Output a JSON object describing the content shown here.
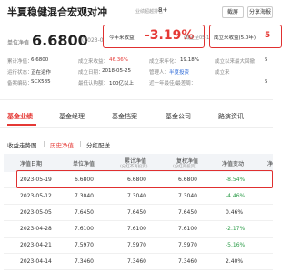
{
  "header": {
    "fund_name": "半夏稳健混合宏观对冲",
    "rating_label": "业绩超越排名",
    "rating_value": "8+",
    "screenshot_label": "截屏",
    "share_label": "分享海报"
  },
  "nav": {
    "label": "单位净值",
    "value": "6.6800",
    "date": "(2023-05-19)"
  },
  "return_box": {
    "label": "今年来收益",
    "value": "-3.19%",
    "note": "(截止至05-19)"
  },
  "since_box": {
    "label": "成立来收益(5.0年)",
    "value_partial": "5"
  },
  "info": {
    "row1": {
      "cum_label": "累计净值：",
      "cum_value": "6.6800",
      "since_label": "成立来收益：",
      "since_value": "46.36%",
      "ann_label": "成立来年化：",
      "ann_value": "19.18%",
      "dd_label": "成立以来最大回撤：",
      "dd_value": "5"
    },
    "row2": {
      "status_label": "运行状态：",
      "status_value": "正在运作",
      "date_label": "成立日期：",
      "date_value": "2018-05-25",
      "mgr_label": "管理人：",
      "mgr_value": "半夏投资",
      "extra_label": "成立来"
    },
    "row3": {
      "code_label": "备案编码：",
      "code_value": "SCX585",
      "min_label": "最低认购额：",
      "min_value": "100亿以上",
      "week_label": "近一年最佳/最差周：",
      "week_value": "5"
    }
  },
  "tabs": [
    {
      "label": "基金业绩"
    },
    {
      "label": "基金经理"
    },
    {
      "label": "基金档案"
    },
    {
      "label": "基金公司"
    },
    {
      "label": "路演资讯"
    }
  ],
  "subtabs": [
    {
      "label": "收益走势图"
    },
    {
      "label": "历史净值"
    },
    {
      "label": "分红配送"
    }
  ],
  "table": {
    "headers": {
      "date": "净值日期",
      "nav": "单位净值",
      "cum": "累计净值",
      "cum_sub": "(分红不再投资)",
      "adj": "复权净值",
      "adj_sub": "(分红再投资)",
      "change": "净值变动",
      "last": "净"
    },
    "rows": [
      {
        "date": "2023-05-19",
        "nav": "6.6800",
        "cum": "6.6800",
        "adj": "6.6800",
        "change": "-8.54%"
      },
      {
        "date": "2023-05-12",
        "nav": "7.3040",
        "cum": "7.3040",
        "adj": "7.3040",
        "change": "-4.46%"
      },
      {
        "date": "2023-05-05",
        "nav": "7.6450",
        "cum": "7.6450",
        "adj": "7.6450",
        "change": "0.46%"
      },
      {
        "date": "2023-04-28",
        "nav": "7.6100",
        "cum": "7.6100",
        "adj": "7.6100",
        "change": "-2.17%"
      },
      {
        "date": "2023-04-21",
        "nav": "7.5970",
        "cum": "7.5970",
        "adj": "7.5970",
        "change": "-5.16%"
      },
      {
        "date": "2023-04-14",
        "nav": "7.3460",
        "cum": "7.3460",
        "adj": "7.3460",
        "change": "2.40%"
      }
    ]
  },
  "colors": {
    "accent": "#e53935",
    "positive": "#e53935",
    "negative": "#2e9d4a",
    "link": "#2f6bd8"
  }
}
